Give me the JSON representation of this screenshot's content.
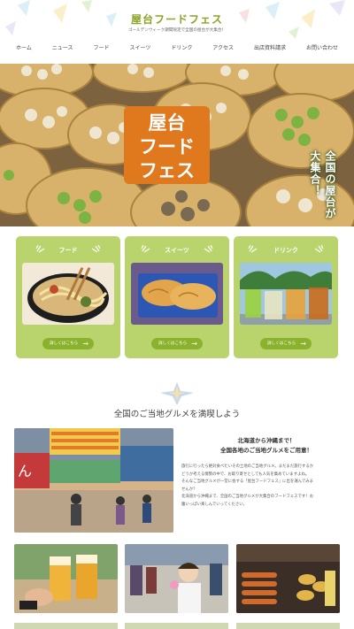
{
  "header": {
    "title": "屋台フードフェス",
    "subtitle": "ゴールデンウィーク期間限定で全国の屋台が大集合！"
  },
  "nav": {
    "items": [
      {
        "label": "ホーム"
      },
      {
        "label": "ニュース"
      },
      {
        "label": "フード"
      },
      {
        "label": "スイーツ"
      },
      {
        "label": "ドリンク"
      },
      {
        "label": "アクセス"
      },
      {
        "label": "出店資料請求"
      },
      {
        "label": "お問い合わせ"
      }
    ]
  },
  "hero": {
    "logo_line1": "屋台",
    "logo_line2": "フード",
    "logo_line3": "フェス",
    "vertical_text": "全国の屋台が大集合！"
  },
  "cards": [
    {
      "title": "フード",
      "button": "詳しくはこちら",
      "photo_icon": "ramen-photo"
    },
    {
      "title": "スイーツ",
      "button": "詳しくはこちら",
      "photo_icon": "taiyaki-photo"
    },
    {
      "title": "ドリンク",
      "button": "詳しくはこちら",
      "photo_icon": "drinks-photo"
    }
  ],
  "intro": {
    "section_title": "全国のご当地グルメを満喫しよう",
    "heading_line1": "北海道から沖縄まで！",
    "heading_line2": "全国各地のご当地グルメをご用意！",
    "body_lines": [
      "旅行に行ったら絶対食べたいその土地のご当地グルメ。まだまだ旅行するか",
      "どうか考える情勢の中で、お取り寄せとしても人気を集めていますよね。",
      "そんなご当地グルメが一堂に会する「屋台フードフェス」に出を運んでみま",
      "せんか？",
      "北海道から沖縄まで、全国のご当地グルメが大集合のフードフェスです！お",
      "腹いっぱい楽しんでいってください。"
    ]
  },
  "colors": {
    "accent_green": "#b9d46c",
    "button_green": "#8ab22d",
    "logo_orange": "#e0781e",
    "title_green": "#8aa523"
  }
}
